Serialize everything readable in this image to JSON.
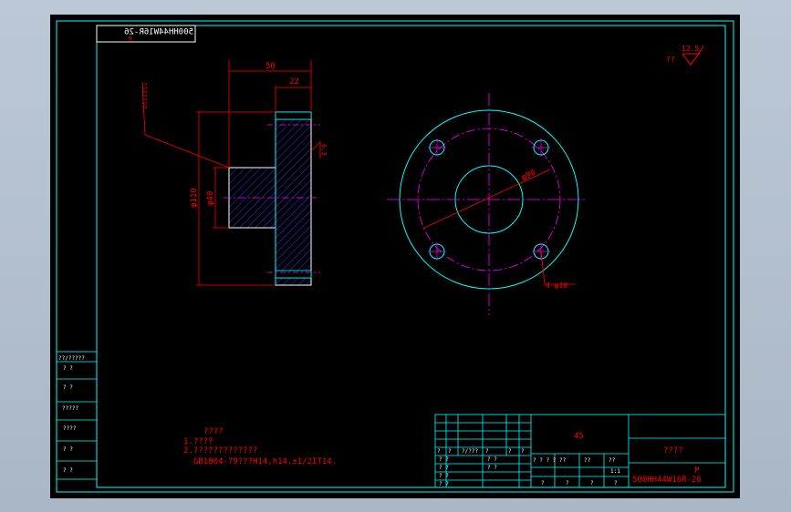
{
  "app": {
    "background": "#b4c1d0",
    "canvas": "#000000"
  },
  "colors": {
    "frame": "#00ffff",
    "dimension": "#ff0000",
    "centerline": "#ff00ff",
    "hatch": "#3333ff",
    "text_white": "#ffffff"
  },
  "drawing_number_mirrored": "500HH44W16R-26",
  "drawing_number_mirrored_sub": "P",
  "roughness": {
    "value": "12.5",
    "prefix": "??"
  },
  "side_view": {
    "dim_50": "50",
    "dim_22": "22",
    "dim_110": "φ110",
    "dim_40": "φ40",
    "leader_note": "???????",
    "surface_mark": "6.3"
  },
  "front_view": {
    "dim_90": "φ90",
    "holes_note": "4-φ10"
  },
  "notes": {
    "title": "????",
    "line1": "1.????",
    "line2": "2.?????????????",
    "line3": "GB1804-79???H14,h14,±1/2IT14."
  },
  "left_panel": [
    "??/?????",
    "?    ?",
    "?    ?",
    "?????",
    "????",
    "?    ?",
    "?    ?"
  ],
  "title_block": {
    "material": "45",
    "part_name": "????",
    "sheet_mark": "P",
    "drawing_number": "500HH44W16R-26",
    "scale_label": "1:1",
    "header_row": [
      "?",
      "?",
      "?/???",
      "?",
      "?",
      "?"
    ],
    "sign_cells": [
      "? ?",
      "? ?",
      "? ?",
      "? ?",
      "? ?",
      "? ?"
    ],
    "mid_row": [
      "? ? ? ?",
      "??",
      "??",
      "??"
    ],
    "mid_row2": [
      "?",
      "?",
      "?",
      "?"
    ]
  }
}
